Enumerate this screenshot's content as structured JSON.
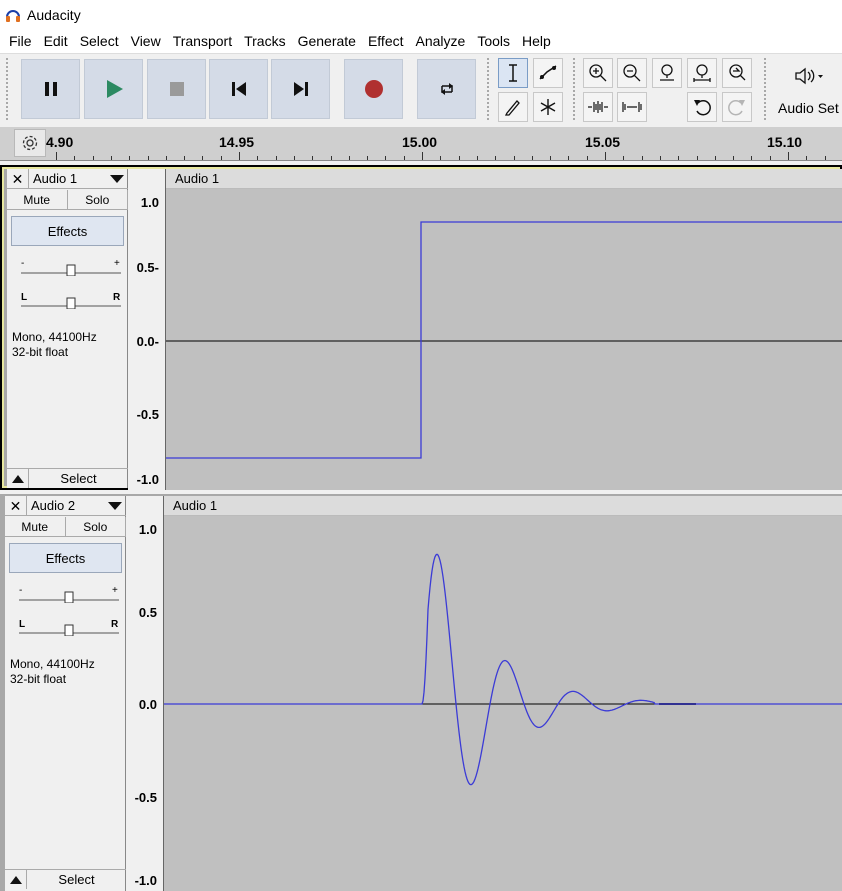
{
  "window": {
    "title": "Audacity"
  },
  "menu": [
    "File",
    "Edit",
    "Select",
    "View",
    "Transport",
    "Tracks",
    "Generate",
    "Effect",
    "Analyze",
    "Tools",
    "Help"
  ],
  "audio_setup": {
    "label": "Audio Set"
  },
  "ruler": {
    "labels": [
      "4.90",
      "14.95",
      "15.00",
      "15.05",
      "15.10"
    ]
  },
  "tracks": [
    {
      "name": "Audio 1",
      "mute": "Mute",
      "solo": "Solo",
      "effects": "Effects",
      "info1": "Mono, 44100Hz",
      "info2": "32-bit float",
      "select": "Select",
      "clip_name": "Audio 1",
      "scale": [
        "1.0",
        "0.5-",
        "0.0-",
        "-0.5",
        "-1.0"
      ]
    },
    {
      "name": "Audio 2",
      "mute": "Mute",
      "solo": "Solo",
      "effects": "Effects",
      "info1": "Mono, 44100Hz",
      "info2": "32-bit float",
      "select": "Select",
      "clip_name": "Audio 1",
      "scale": [
        "1.0",
        "0.5",
        "0.0",
        "-0.5",
        "-1.0"
      ]
    }
  ],
  "slider_labels": {
    "gain_minus": "-",
    "gain_plus": "+",
    "pan_left": "L",
    "pan_right": "R"
  },
  "colors": {
    "wave": "#3b3bd6",
    "record": "#b03030",
    "play": "#2c8a62"
  }
}
